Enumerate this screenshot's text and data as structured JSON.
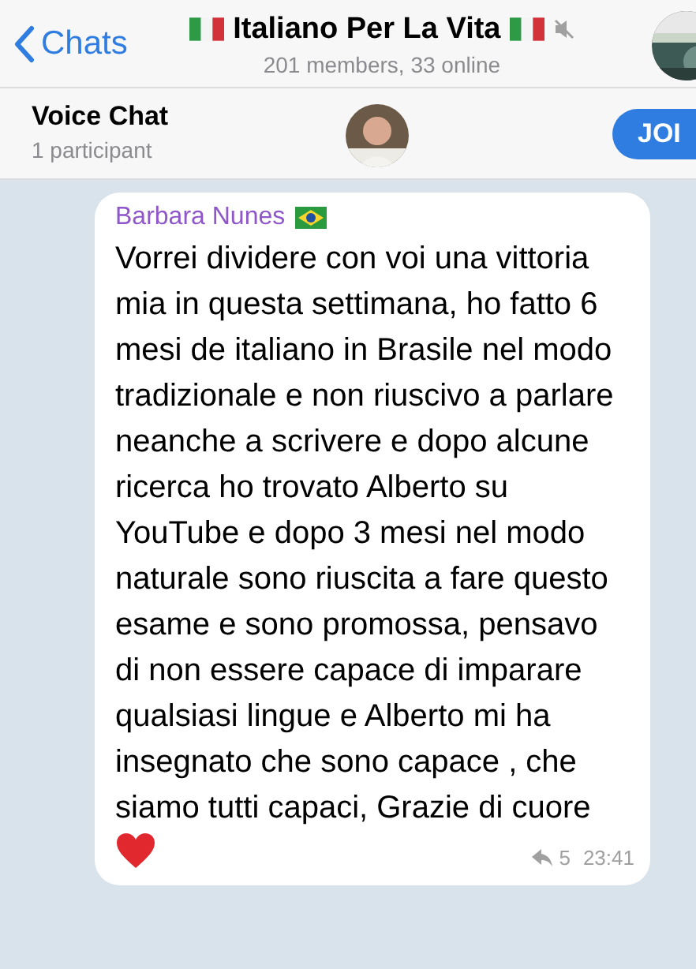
{
  "header": {
    "back_label": "Chats",
    "title": "Italiano Per La Vita",
    "subtitle": "201 members, 33 online",
    "muted": true
  },
  "voice_chat": {
    "title": "Voice Chat",
    "participants": "1 participant",
    "join_label": "JOI"
  },
  "message": {
    "sender": "Barbara Nunes",
    "text": "Vorrei dividere con voi una vittoria mia in questa settimana, ho fatto 6 mesi de italiano in Brasile nel modo tradizionale e non riuscivo a parlare neanche a scrivere e dopo alcune ricerca ho trovato Alberto su YouTube e dopo 3 mesi nel modo naturale sono riuscita a fare questo esame e sono promossa, pensavo di non essere capace di imparare qualsiasi lingue e Alberto mi ha insegnato che sono capace , che siamo tutti capaci, Grazie di cuore",
    "forwards": "5",
    "time": "23:41"
  }
}
